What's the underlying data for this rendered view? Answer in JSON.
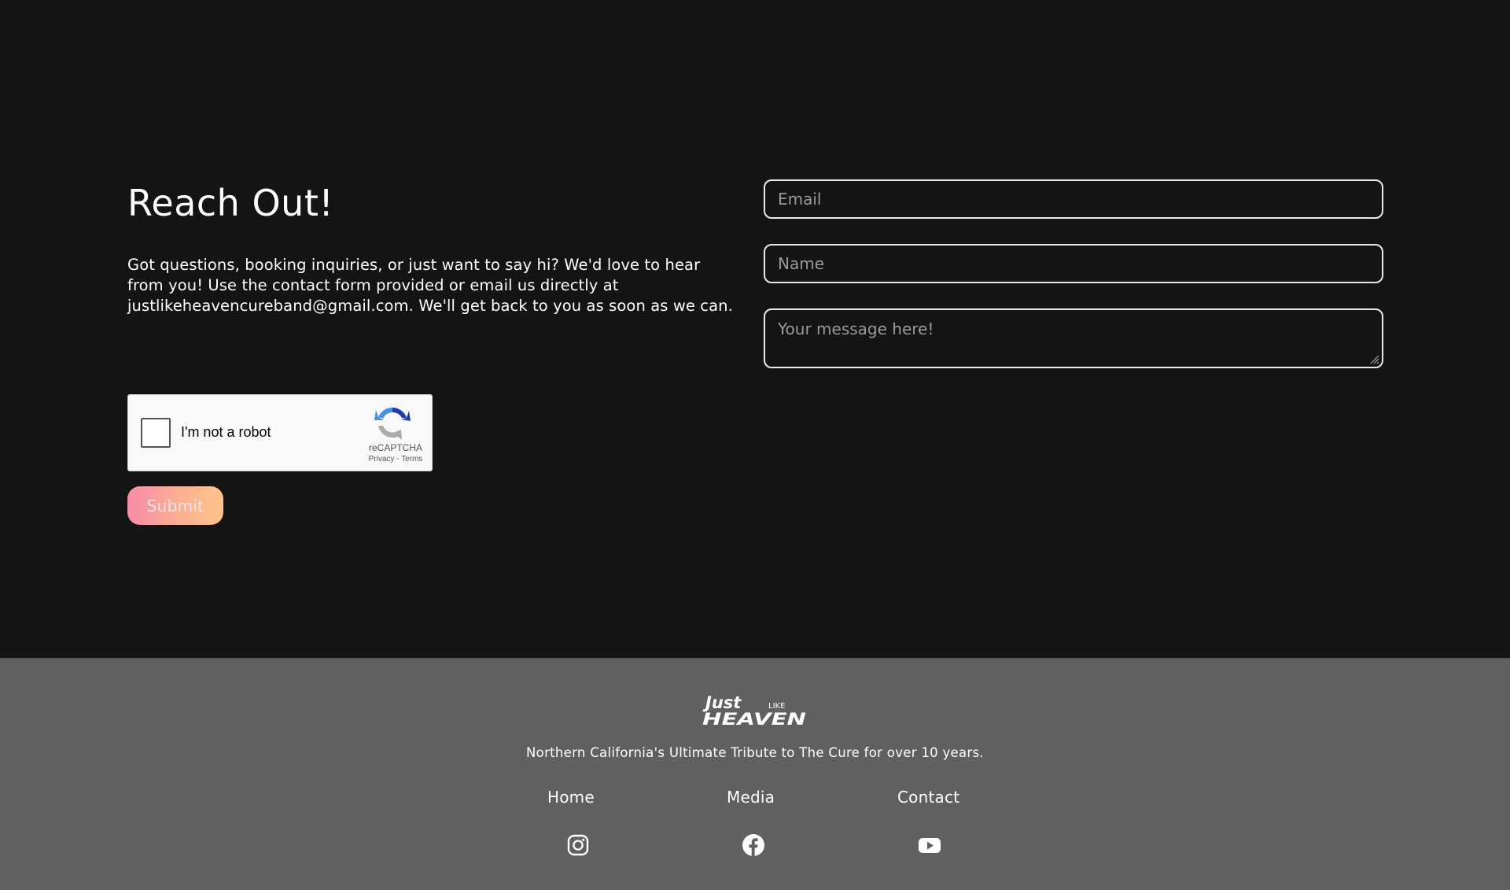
{
  "contact": {
    "heading": "Reach Out!",
    "intro": "Got questions, booking inquiries, or just want to say hi? We'd love to hear from you! Use the contact form provided or email us directly at justlikeheavencureband@gmail.com. We'll get back to you as soon as we can.",
    "form": {
      "email_placeholder": "Email",
      "name_placeholder": "Name",
      "message_placeholder": "Your message here!",
      "submit_label": "Submit"
    },
    "recaptcha": {
      "label": "I'm not a robot",
      "brand": "reCAPTCHA",
      "privacy": "Privacy",
      "separator": " - ",
      "terms": "Terms"
    }
  },
  "footer": {
    "logo_text": {
      "line1": "Just",
      "small": "LIKE",
      "line2": "HEAVEN"
    },
    "tagline": "Northern California's Ultimate Tribute to The Cure for over 10 years.",
    "nav": [
      {
        "label": "Home"
      },
      {
        "label": "Media"
      },
      {
        "label": "Contact"
      }
    ],
    "social": [
      {
        "icon": "instagram-icon"
      },
      {
        "icon": "facebook-icon"
      },
      {
        "icon": "youtube-icon"
      }
    ]
  },
  "colors": {
    "background": "#141414",
    "footer_bg": "#606060",
    "field_border": "#e9e9e9",
    "submit_gradient_start": "#f78ca8",
    "submit_gradient_end": "#fec38c"
  }
}
